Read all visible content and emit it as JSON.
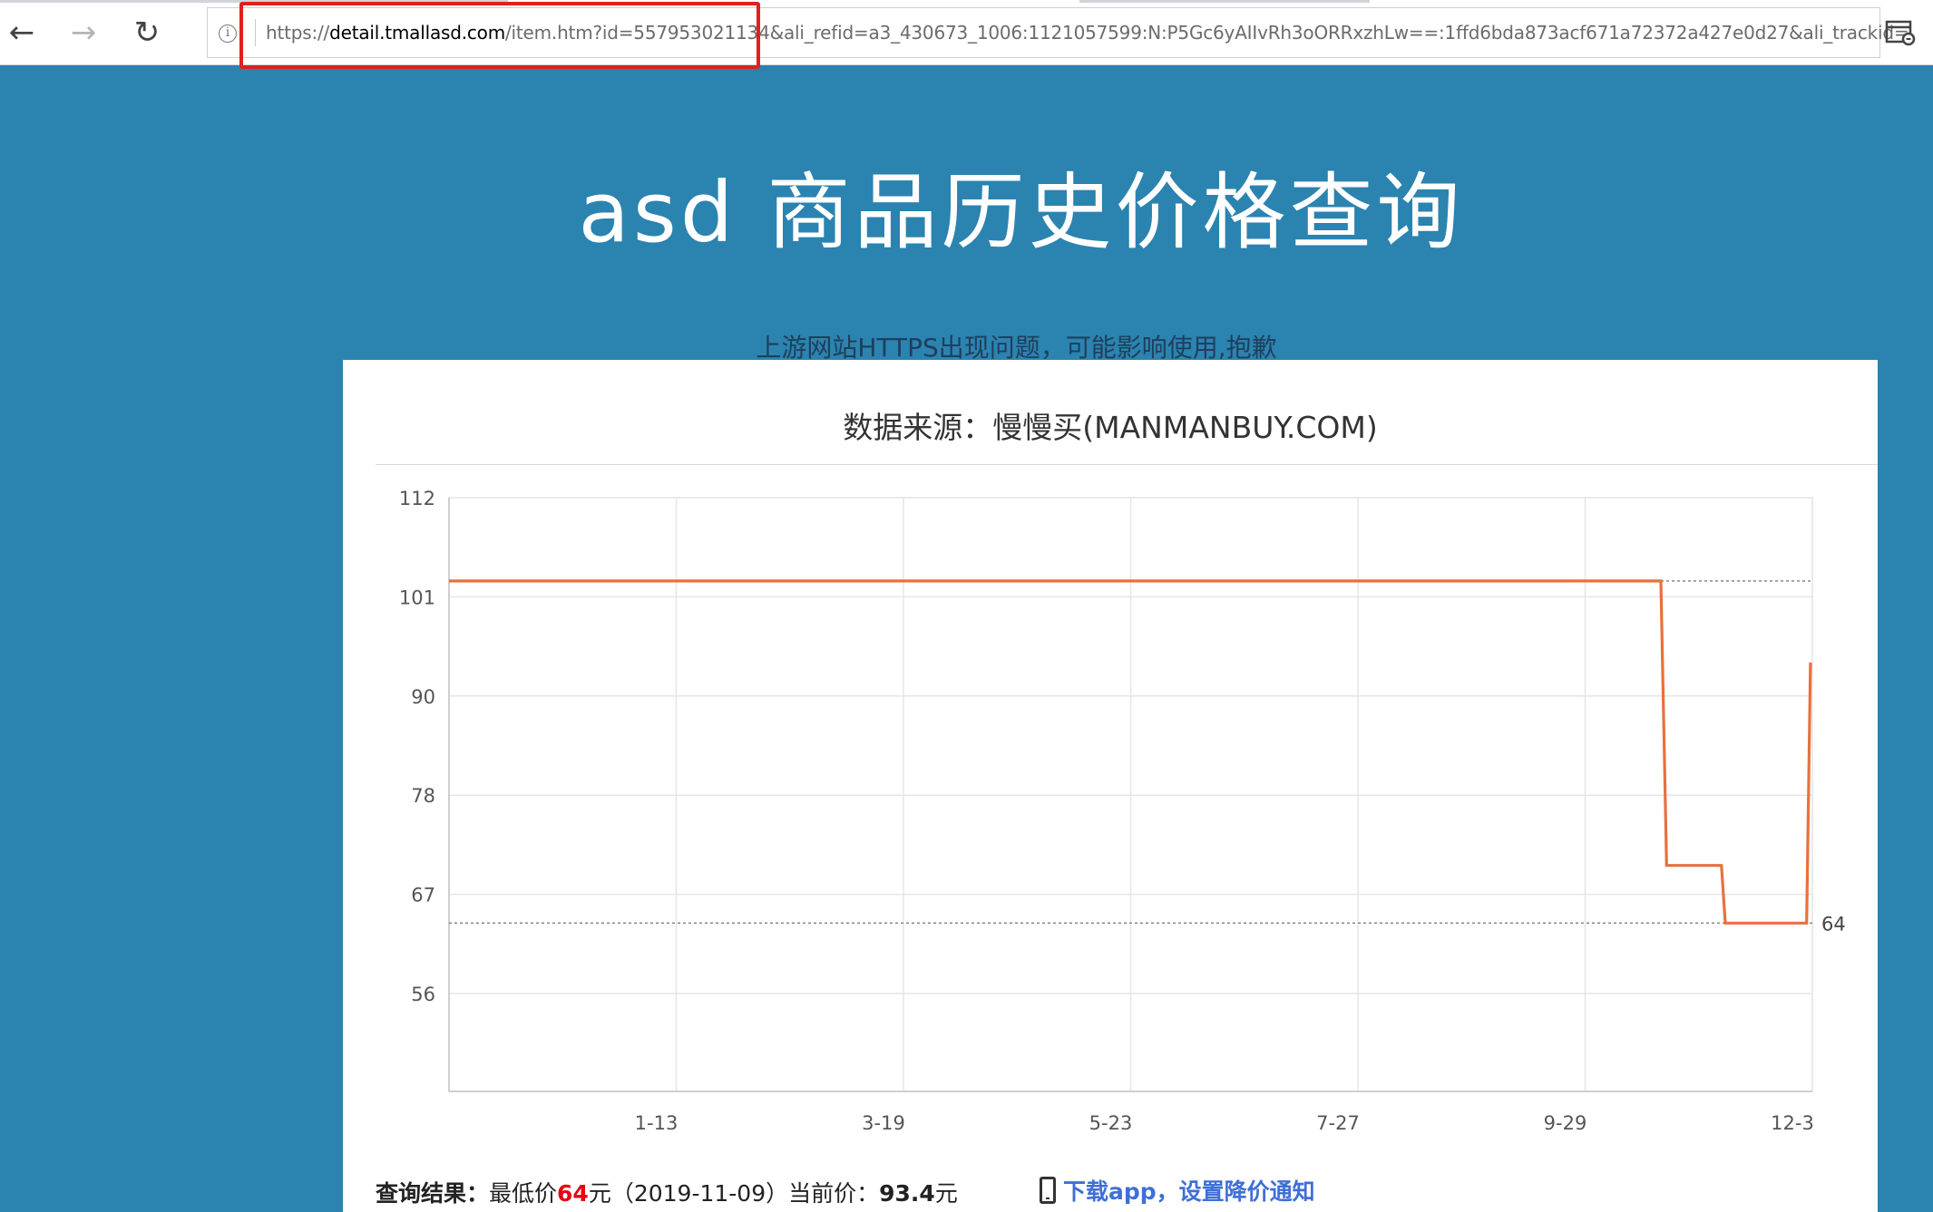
{
  "browser": {
    "back_icon": "←",
    "forward_icon": "→",
    "refresh_icon": "↻",
    "info_icon": "i",
    "url_scheme": "https://",
    "url_host": "detail.tmallasd.com",
    "url_path": "/item.htm?id=557953021134&ali_refid=a3_430673_1006:1121057599:N:P5Gc6yAIIvRh3oORRxzhLw==:1ffd6bda873acf671a72372a427e0d27&ali_trackid="
  },
  "page": {
    "title": "asd 商品历史价格查询",
    "notice": "上游网站HTTPS出现问题，可能影响使用,抱歉"
  },
  "card": {
    "title": "数据来源：慢慢买(MANMANBUY.COM)"
  },
  "chart_data": {
    "type": "line",
    "title": "",
    "xlabel": "",
    "ylabel": "",
    "x_tick_labels": [
      "1-13",
      "3-19",
      "5-23",
      "7-27",
      "9-29",
      "12-3"
    ],
    "y_tick_labels": [
      "112",
      "101",
      "90",
      "78",
      "67",
      "56"
    ],
    "ylim": [
      45,
      112
    ],
    "x_range_days": [
      0,
      360
    ],
    "grid": true,
    "series": [
      {
        "points": [
          {
            "day": 0,
            "price": 102.6
          },
          {
            "day": 320,
            "price": 102.6
          },
          {
            "day": 321.5,
            "price": 70.5
          },
          {
            "day": 336,
            "price": 70.5
          },
          {
            "day": 337,
            "price": 64
          },
          {
            "day": 358.5,
            "price": 64
          },
          {
            "day": 359.5,
            "price": 93.4
          }
        ],
        "color": "#e8703d"
      }
    ],
    "reference_lines": [
      {
        "value": 102.6,
        "label": ""
      },
      {
        "value": 64,
        "label": "64"
      }
    ]
  },
  "result": {
    "label": "查询结果：",
    "low_prefix": "最低价",
    "low_value": "64",
    "low_suffix": "元（2019-11-09）当前价：",
    "current_value": "93.4",
    "current_suffix": "元"
  },
  "app_link": {
    "text": "下载app，设置降价通知"
  }
}
